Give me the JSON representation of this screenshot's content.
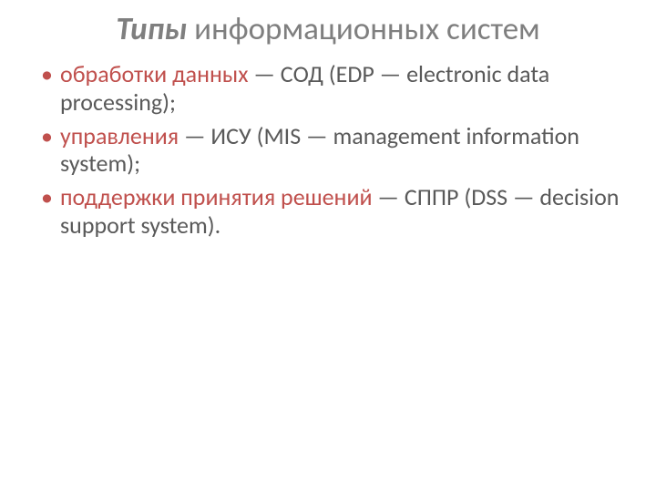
{
  "title": {
    "emphasis": "Типы",
    "rest": " информационных систем"
  },
  "items": [
    {
      "emphasis": "обработки данных",
      "rest": " — СОД (EDP — electronic data processing);"
    },
    {
      "emphasis": "управления",
      "rest": " — ИСУ (MIS — management information system);"
    },
    {
      "emphasis": "поддержки принятия решений",
      "rest": " — СППР (DSS — decision support system)."
    }
  ]
}
